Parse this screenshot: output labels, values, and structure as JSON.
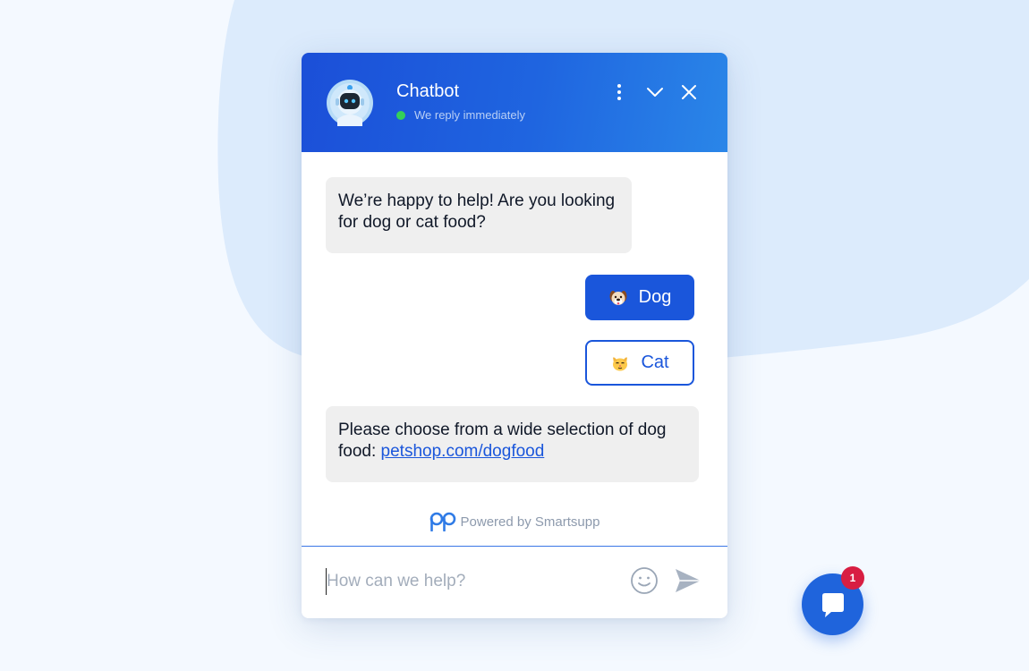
{
  "header": {
    "title": "Chatbot",
    "status_text": "We reply immediately",
    "status_color": "#34d058",
    "menu_icon": "more-vertical-icon",
    "minimize_icon": "chevron-down-icon",
    "close_icon": "close-icon"
  },
  "messages": [
    {
      "sender": "bot",
      "text": "We’re happy to help! Are you looking for dog or cat food?"
    },
    {
      "sender": "bot",
      "text_prefix": "Please choose from a wide selection of dog food: ",
      "link_text": "petshop.com/dogfood"
    }
  ],
  "quick_replies": [
    {
      "label": "Dog",
      "emoji_icon": "dog-face-icon",
      "selected": true
    },
    {
      "label": "Cat",
      "emoji_icon": "cat-face-icon",
      "selected": false
    }
  ],
  "footer": {
    "powered_by": "Powered by Smartsupp"
  },
  "input": {
    "placeholder": "How can we help?",
    "value": ""
  },
  "launcher": {
    "badge_count": "1"
  },
  "colors": {
    "accent": "#1a56db",
    "header_gradient_start": "#1b4fd8",
    "header_gradient_end": "#2a86e8",
    "badge": "#d81e42"
  }
}
